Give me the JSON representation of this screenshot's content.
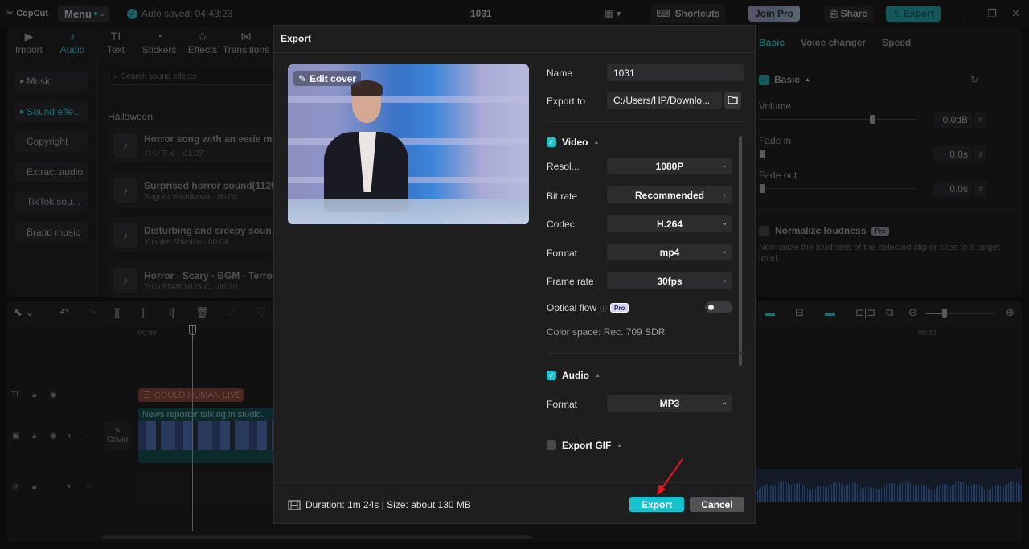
{
  "app": {
    "logo": "CopCut",
    "menu_label": "Menu",
    "autosave": "Auto saved: 04:43:23",
    "project_title": "1031",
    "shortcuts_label": "Shortcuts",
    "join_pro_label": "Join Pro",
    "share_label": "Share",
    "export_label": "Export"
  },
  "media_tabs": [
    {
      "label": "Import",
      "icon": "import-icon",
      "glyph": "▶"
    },
    {
      "label": "Audio",
      "icon": "audio-icon",
      "glyph": "♪",
      "active": true
    },
    {
      "label": "Text",
      "icon": "text-icon",
      "glyph": "TI"
    },
    {
      "label": "Stickers",
      "icon": "sticker-icon",
      "glyph": "◔"
    },
    {
      "label": "Effects",
      "icon": "effects-icon",
      "glyph": "✩"
    },
    {
      "label": "Transitions",
      "icon": "transitions-icon",
      "glyph": "⋈"
    }
  ],
  "audio_nav": [
    {
      "label": "Music",
      "caret": true
    },
    {
      "label": "Sound effe...",
      "caret": true,
      "active": true
    },
    {
      "label": "Copyright"
    },
    {
      "label": "Extract audio"
    },
    {
      "label": "TikTok sou..."
    },
    {
      "label": "Brand music"
    }
  ],
  "search": {
    "placeholder": "Search sound effects"
  },
  "sound_section": "Halloween",
  "sounds": [
    {
      "title": "Horror song with an eerie m",
      "sub": "ハシマミ · 01:07"
    },
    {
      "title": "Surprised horror sound(1120",
      "sub": "Suguru Yoshikawa · 00:04"
    },
    {
      "title": "Disturbing and creepy soun",
      "sub": "Yusuke Shimizu · 00:04"
    },
    {
      "title": "Horror · Scary · BGM · Terro",
      "sub": "TrickSTAR MUSIC · 00:20"
    }
  ],
  "right_panel": {
    "tabs": [
      "Basic",
      "Voice changer",
      "Speed"
    ],
    "active_tab": "Basic",
    "basic_label": "Basic",
    "volume": {
      "label": "Volume",
      "value": "0.0dB",
      "position": 0.72
    },
    "fade_in": {
      "label": "Fade in",
      "value": "0.0s",
      "position": 0
    },
    "fade_out": {
      "label": "Fade out",
      "value": "0.0s",
      "position": 0
    },
    "normalize": {
      "label": "Normalize loudness",
      "badge": "Pro",
      "desc": "Normalize the loudness of the selected clip or clips to a target level."
    }
  },
  "timeline": {
    "ruler": [
      "00:00",
      "00:40"
    ],
    "text_clip": "COULD HUMAN LIVE C",
    "video_clip": "News reporter talking in studio.",
    "cover_label": "Cover",
    "zoom_level": 0.25
  },
  "export_dialog": {
    "title": "Export",
    "edit_cover": "Edit cover",
    "name_label": "Name",
    "name_value": "1031",
    "export_to_label": "Export to",
    "export_to_value": "C:/Users/HP/Downlo...",
    "video": {
      "label": "Video",
      "checked": true,
      "resolution_label": "Resol...",
      "resolution": "1080P",
      "bitrate_label": "Bit rate",
      "bitrate": "Recommended",
      "codec_label": "Codec",
      "codec": "H.264",
      "format_label": "Format",
      "format": "mp4",
      "framerate_label": "Frame rate",
      "framerate": "30fps",
      "optical_flow_label": "Optical flow",
      "optical_flow_badge": "Pro",
      "optical_flow_on": false,
      "color_space": "Color space: Rec. 709 SDR"
    },
    "audio": {
      "label": "Audio",
      "checked": true,
      "format_label": "Format",
      "format": "MP3"
    },
    "gif": {
      "label": "Export GIF",
      "checked": false
    },
    "footer_info": "Duration: 1m 24s | Size: about 130 MB",
    "export_button": "Export",
    "cancel_button": "Cancel"
  },
  "colors": {
    "accent": "#18c3d0",
    "annotation_arrow": "#e8151b"
  }
}
